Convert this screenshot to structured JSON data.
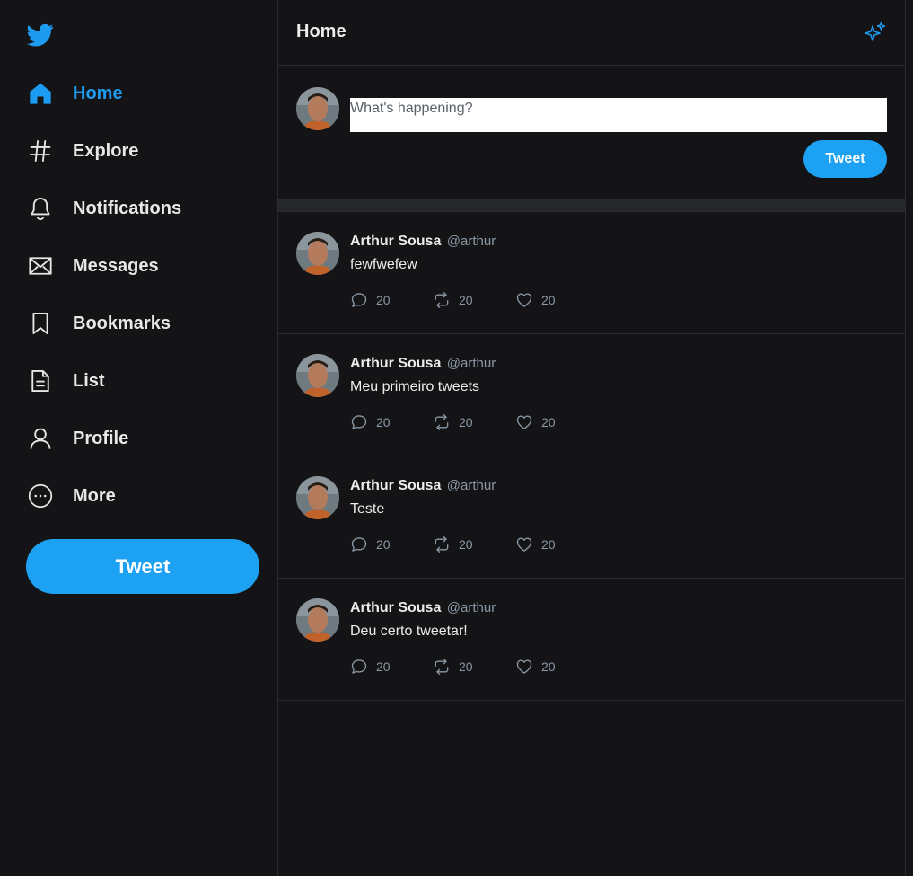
{
  "colors": {
    "accent": "#1d9bf0",
    "background": "#141416",
    "border": "#2c2c30",
    "muted": "#8b98a5"
  },
  "sidebar": {
    "logo_icon": "twitter-bird-icon",
    "items": [
      {
        "label": "Home",
        "icon": "home-icon",
        "active": true
      },
      {
        "label": "Explore",
        "icon": "hashtag-icon"
      },
      {
        "label": "Notifications",
        "icon": "bell-icon"
      },
      {
        "label": "Messages",
        "icon": "envelope-icon"
      },
      {
        "label": "Bookmarks",
        "icon": "bookmark-icon"
      },
      {
        "label": "List",
        "icon": "list-icon"
      },
      {
        "label": "Profile",
        "icon": "user-icon"
      },
      {
        "label": "More",
        "icon": "more-icon"
      }
    ],
    "tweet_button": "Tweet"
  },
  "header": {
    "title": "Home",
    "action_icon": "sparkle-icon"
  },
  "composer": {
    "placeholder": "What's happening?",
    "value": "",
    "tweet_button": "Tweet"
  },
  "tweets": [
    {
      "name": "Arthur Sousa",
      "handle": "@arthur",
      "text": "fewfwefew",
      "replies": "20",
      "retweets": "20",
      "likes": "20"
    },
    {
      "name": "Arthur Sousa",
      "handle": "@arthur",
      "text": "Meu primeiro tweets",
      "replies": "20",
      "retweets": "20",
      "likes": "20"
    },
    {
      "name": "Arthur Sousa",
      "handle": "@arthur",
      "text": "Teste",
      "replies": "20",
      "retweets": "20",
      "likes": "20"
    },
    {
      "name": "Arthur Sousa",
      "handle": "@arthur",
      "text": "Deu certo tweetar!",
      "replies": "20",
      "retweets": "20",
      "likes": "20"
    }
  ]
}
